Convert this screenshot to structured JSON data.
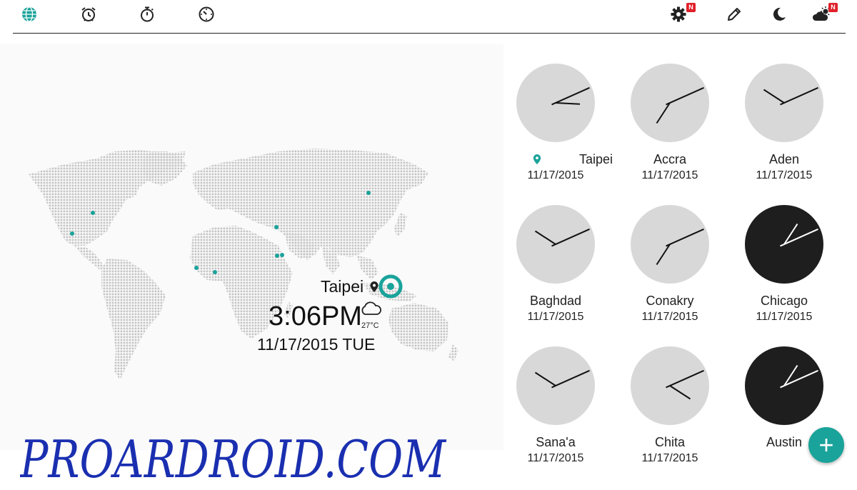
{
  "colors": {
    "accent": "#1aa39a",
    "badge": "#e0202a",
    "clock_light": "#d8d8d8",
    "clock_dark": "#1e1e1e",
    "map_dot": "#c4c4c4",
    "watermark": "#1a2fb0"
  },
  "toolbar": {
    "left_icons": [
      "globe-icon",
      "alarm-clock-icon",
      "stopwatch-icon",
      "timer-icon"
    ],
    "right_icons": [
      "settings-icon",
      "edit-icon",
      "night-mode-icon",
      "weather-icon"
    ],
    "settings_badge": "N",
    "weather_badge": "N"
  },
  "map": {
    "city": "Taipei",
    "time": "3:06PM",
    "temperature": "27°C",
    "date": "11/17/2015 TUE",
    "weather_icon": "cloud-icon"
  },
  "clocks": [
    {
      "city": "Taipei",
      "date": "11/17/2015",
      "theme": "light",
      "is_home": true,
      "hour": 3,
      "minute": 6
    },
    {
      "city": "Accra",
      "date": "11/17/2015",
      "theme": "light",
      "is_home": false,
      "hour": 7,
      "minute": 6
    },
    {
      "city": "Aden",
      "date": "11/17/2015",
      "theme": "light",
      "is_home": false,
      "hour": 10,
      "minute": 6
    },
    {
      "city": "Baghdad",
      "date": "11/17/2015",
      "theme": "light",
      "is_home": false,
      "hour": 10,
      "minute": 6
    },
    {
      "city": "Conakry",
      "date": "11/17/2015",
      "theme": "light",
      "is_home": false,
      "hour": 7,
      "minute": 6
    },
    {
      "city": "Chicago",
      "date": "11/17/2015",
      "theme": "dark",
      "is_home": false,
      "hour": 1,
      "minute": 6
    },
    {
      "city": "Sana'a",
      "date": "11/17/2015",
      "theme": "light",
      "is_home": false,
      "hour": 10,
      "minute": 6
    },
    {
      "city": "Chita",
      "date": "11/17/2015",
      "theme": "light",
      "is_home": false,
      "hour": 4,
      "minute": 6
    },
    {
      "city": "Austin",
      "date": "",
      "theme": "dark",
      "is_home": false,
      "hour": 1,
      "minute": 6
    }
  ],
  "fab_label": "+",
  "watermark": "PROARDROID.COM"
}
